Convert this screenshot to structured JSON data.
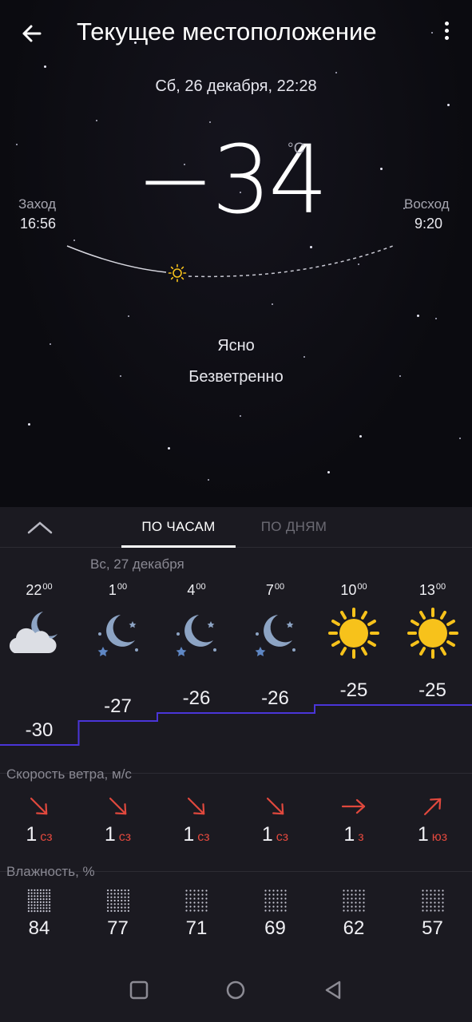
{
  "header": {
    "title": "Текущее местоположение",
    "datetime": "Сб, 26 декабря, 22:28"
  },
  "current": {
    "temperature": "−34",
    "unit": "°C",
    "condition": "Ясно",
    "wind": "Безветренно"
  },
  "sun": {
    "sunset_label": "Заход",
    "sunset_time": "16:56",
    "sunrise_label": "Восход",
    "sunrise_time": "9:20"
  },
  "tabs": {
    "hourly": "ПО ЧАСАМ",
    "daily": "ПО ДНЯМ"
  },
  "forecast": {
    "day_label": "Вс, 27 декабря",
    "hours": [
      {
        "hour": "22",
        "min": "00",
        "icon": "partly-cloudy-night-icon",
        "temp": "-30",
        "wind": "1",
        "dir": "сз",
        "humidity": "84"
      },
      {
        "hour": "1",
        "min": "00",
        "icon": "clear-night-icon",
        "temp": "-27",
        "wind": "1",
        "dir": "сз",
        "humidity": "77"
      },
      {
        "hour": "4",
        "min": "00",
        "icon": "clear-night-icon",
        "temp": "-26",
        "wind": "1",
        "dir": "сз",
        "humidity": "71"
      },
      {
        "hour": "7",
        "min": "00",
        "icon": "clear-night-icon",
        "temp": "-26",
        "wind": "1",
        "dir": "сз",
        "humidity": "69"
      },
      {
        "hour": "10",
        "min": "00",
        "icon": "sun-icon",
        "temp": "-25",
        "wind": "1",
        "dir": "з",
        "humidity": "62"
      },
      {
        "hour": "13",
        "min": "00",
        "icon": "sun-icon",
        "temp": "-25",
        "wind": "1",
        "dir": "юз",
        "humidity": "57"
      }
    ]
  },
  "labels": {
    "wind_speed": "Скорость ветра, м/с",
    "humidity": "Влажность, %"
  },
  "colors": {
    "accent_line": "#4a35d8",
    "wind_arrow": "#e0483d",
    "sun": "#f7c21b",
    "moon": "#8da4c4",
    "panel_bg": "#1b1a21"
  }
}
